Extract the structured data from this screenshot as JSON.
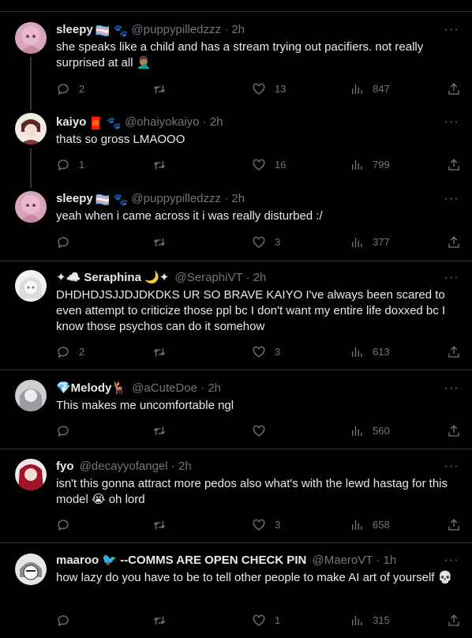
{
  "tweets": [
    {
      "name": "sleepy",
      "name_emoji": "🏳️‍⚧️ 🐾",
      "handle": "@puppypilledzzz",
      "time": "2h",
      "text": "she speaks like a child and has a stream trying out pacifiers. not really surprised at all 🤦🏽‍♂️",
      "replies": "2",
      "retweets": "",
      "likes": "13",
      "views": "847"
    },
    {
      "name": "kaiyo",
      "name_emoji": "🧧 🐾",
      "handle": "@ohaiyokaiyo",
      "time": "2h",
      "text": "thats so gross LMAOOO",
      "replies": "1",
      "retweets": "",
      "likes": "16",
      "views": "799"
    },
    {
      "name": "sleepy",
      "name_emoji": "🏳️‍⚧️ 🐾",
      "handle": "@puppypilledzzz",
      "time": "2h",
      "text": "yeah when i came across it i was really disturbed :/",
      "replies": "",
      "retweets": "",
      "likes": "3",
      "views": "377"
    },
    {
      "name": "✦☁️ Seraphina 🌙✦",
      "name_emoji": "",
      "handle": "@SeraphiVT",
      "time": "2h",
      "text": "DHDHDJSJJDJDKDKS UR SO BRAVE KAIYO I've always been scared to even attempt to criticize those ppl bc I don't want my entire life doxxed bc I know those psychos can do it somehow",
      "replies": "2",
      "retweets": "",
      "likes": "3",
      "views": "613"
    },
    {
      "name": "💎Melody🦌",
      "name_emoji": "",
      "handle": "@aCuteDoe",
      "time": "2h",
      "text": "This makes me uncomfortable ngl",
      "replies": "",
      "retweets": "",
      "likes": "",
      "views": "560"
    },
    {
      "name": "fyo",
      "name_emoji": "",
      "handle": "@decayyofangel",
      "time": "2h",
      "text": "isn't this gonna attract more pedos also what's with the lewd hastag for this model 😭 oh lord",
      "replies": "",
      "retweets": "",
      "likes": "3",
      "views": "658"
    },
    {
      "name": "maaroo 🐦 --COMMS ARE OPEN CHECK PIN",
      "name_emoji": "",
      "handle": "@MaeroVT",
      "time": "1h",
      "text": "how lazy do you have to be to tell other people to make AI art of yourself 💀",
      "replies": "",
      "retweets": "",
      "likes": "1",
      "views": "315"
    }
  ],
  "icons": {
    "reply": "reply-icon",
    "retweet": "retweet-icon",
    "like": "heart-icon",
    "views": "views-icon",
    "share": "share-icon",
    "more": "more-icon"
  },
  "more_glyph": "···",
  "colors": {
    "background": "#000000",
    "text": "#e7e9ea",
    "muted": "#71767b",
    "border": "#2f3336"
  }
}
